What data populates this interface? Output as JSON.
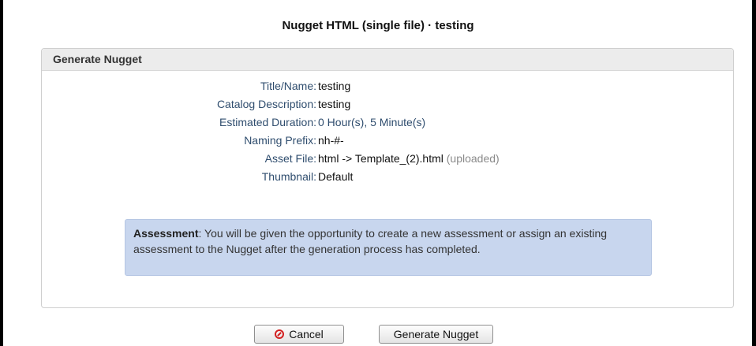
{
  "dialog": {
    "title": "Nugget HTML (single file) · testing"
  },
  "panel": {
    "header": "Generate Nugget",
    "fields": [
      {
        "label": "Title/Name:",
        "value": "testing"
      },
      {
        "label": "Catalog Description:",
        "value": "testing"
      },
      {
        "label": "Estimated Duration:",
        "value": "0 Hour(s), 5 Minute(s)"
      },
      {
        "label": "Naming Prefix:",
        "value": "nh-#-"
      },
      {
        "label": "Asset File:",
        "value": "html -> Template_(2).html",
        "suffix": "(uploaded)"
      },
      {
        "label": "Thumbnail:",
        "value": "Default"
      }
    ],
    "notice": {
      "title": "Assessment",
      "text": ": You will be given the opportunity to create a new assessment or assign an existing assessment to the Nugget after the generation process has completed."
    }
  },
  "buttons": {
    "cancel_label": "Cancel",
    "generate_label": "Generate Nugget"
  },
  "icons": {
    "cancel": "cancel-circle-icon"
  },
  "colors": {
    "notice_bg": "#c8d6ee",
    "label_blue": "#2f4d6e",
    "cancel_red": "#d32020"
  }
}
